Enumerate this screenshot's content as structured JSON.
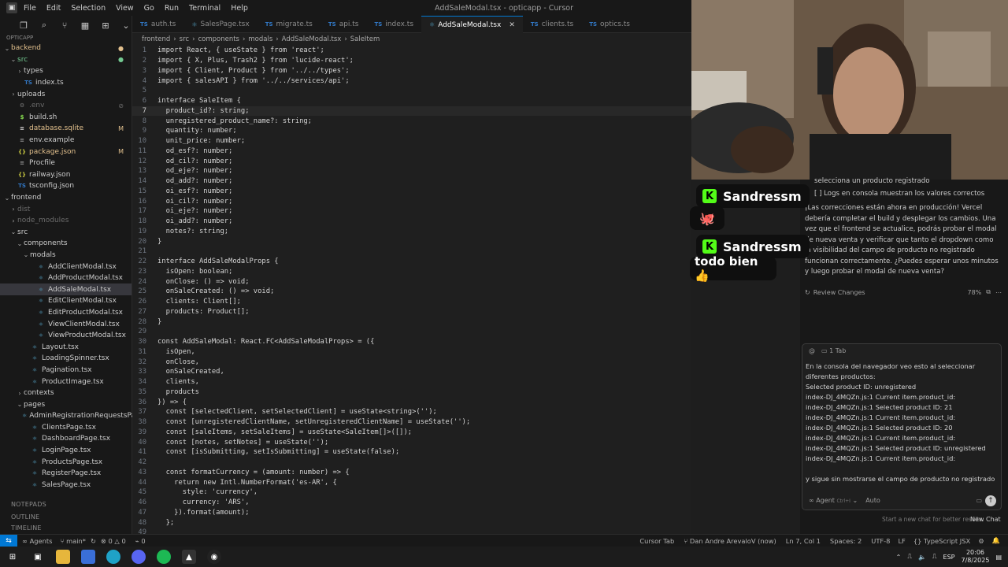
{
  "window": {
    "title": "AddSaleModal.tsx - opticapp - Cursor",
    "menu": [
      "File",
      "Edit",
      "Selection",
      "View",
      "Go",
      "Run",
      "Terminal",
      "Help"
    ]
  },
  "explorer": {
    "header": "OPTICAPP",
    "items": [
      {
        "label": "backend",
        "depth": 0,
        "kind": "folder-open",
        "state": "mod",
        "badge": "●"
      },
      {
        "label": "src",
        "depth": 1,
        "kind": "folder-open",
        "state": "add",
        "badge": "●"
      },
      {
        "label": "types",
        "depth": 2,
        "kind": "folder",
        "state": ""
      },
      {
        "label": "index.ts",
        "depth": 2,
        "kind": "ts",
        "state": ""
      },
      {
        "label": "uploads",
        "depth": 1,
        "kind": "folder",
        "state": ""
      },
      {
        "label": ".env",
        "depth": 1,
        "kind": "gear",
        "state": "dim",
        "badge": "⊘"
      },
      {
        "label": "build.sh",
        "depth": 1,
        "kind": "sh",
        "state": ""
      },
      {
        "label": "database.sqlite",
        "depth": 1,
        "kind": "db",
        "state": "mod",
        "badge": "M"
      },
      {
        "label": "env.example",
        "depth": 1,
        "kind": "txt",
        "state": ""
      },
      {
        "label": "package.json",
        "depth": 1,
        "kind": "json",
        "state": "mod",
        "badge": "M"
      },
      {
        "label": "Procfile",
        "depth": 1,
        "kind": "txt",
        "state": ""
      },
      {
        "label": "railway.json",
        "depth": 1,
        "kind": "json",
        "state": ""
      },
      {
        "label": "tsconfig.json",
        "depth": 1,
        "kind": "ts",
        "state": ""
      },
      {
        "label": "frontend",
        "depth": 0,
        "kind": "folder-open",
        "state": ""
      },
      {
        "label": "dist",
        "depth": 1,
        "kind": "folder",
        "state": "dim"
      },
      {
        "label": "node_modules",
        "depth": 1,
        "kind": "folder",
        "state": "dim"
      },
      {
        "label": "src",
        "depth": 1,
        "kind": "folder-open",
        "state": ""
      },
      {
        "label": "components",
        "depth": 2,
        "kind": "folder-open",
        "state": ""
      },
      {
        "label": "modals",
        "depth": 3,
        "kind": "folder-open",
        "state": ""
      },
      {
        "label": "AddClientModal.tsx",
        "depth": 4,
        "kind": "tsx",
        "state": ""
      },
      {
        "label": "AddProductModal.tsx",
        "depth": 4,
        "kind": "tsx",
        "state": ""
      },
      {
        "label": "AddSaleModal.tsx",
        "depth": 4,
        "kind": "tsx",
        "state": "selected"
      },
      {
        "label": "EditClientModal.tsx",
        "depth": 4,
        "kind": "tsx",
        "state": ""
      },
      {
        "label": "EditProductModal.tsx",
        "depth": 4,
        "kind": "tsx",
        "state": ""
      },
      {
        "label": "ViewClientModal.tsx",
        "depth": 4,
        "kind": "tsx",
        "state": ""
      },
      {
        "label": "ViewProductModal.tsx",
        "depth": 4,
        "kind": "tsx",
        "state": ""
      },
      {
        "label": "Layout.tsx",
        "depth": 3,
        "kind": "tsx",
        "state": ""
      },
      {
        "label": "LoadingSpinner.tsx",
        "depth": 3,
        "kind": "tsx",
        "state": ""
      },
      {
        "label": "Pagination.tsx",
        "depth": 3,
        "kind": "tsx",
        "state": ""
      },
      {
        "label": "ProductImage.tsx",
        "depth": 3,
        "kind": "tsx",
        "state": ""
      },
      {
        "label": "contexts",
        "depth": 2,
        "kind": "folder",
        "state": ""
      },
      {
        "label": "pages",
        "depth": 2,
        "kind": "folder-open",
        "state": ""
      },
      {
        "label": "AdminRegistrationRequestsPag...",
        "depth": 3,
        "kind": "tsx",
        "state": ""
      },
      {
        "label": "ClientsPage.tsx",
        "depth": 3,
        "kind": "tsx",
        "state": ""
      },
      {
        "label": "DashboardPage.tsx",
        "depth": 3,
        "kind": "tsx",
        "state": ""
      },
      {
        "label": "LoginPage.tsx",
        "depth": 3,
        "kind": "tsx",
        "state": ""
      },
      {
        "label": "ProductsPage.tsx",
        "depth": 3,
        "kind": "tsx",
        "state": ""
      },
      {
        "label": "RegisterPage.tsx",
        "depth": 3,
        "kind": "tsx",
        "state": ""
      },
      {
        "label": "SalesPage.tsx",
        "depth": 3,
        "kind": "tsx",
        "state": ""
      }
    ],
    "sections": [
      "NOTEPADS",
      "OUTLINE",
      "TIMELINE"
    ]
  },
  "tabs": [
    {
      "label": "auth.ts",
      "kind": "ts"
    },
    {
      "label": "SalesPage.tsx",
      "kind": "tsx"
    },
    {
      "label": "migrate.ts",
      "kind": "ts"
    },
    {
      "label": "api.ts",
      "kind": "ts"
    },
    {
      "label": "index.ts",
      "kind": "ts"
    },
    {
      "label": "AddSaleModal.tsx",
      "kind": "tsx",
      "active": true
    },
    {
      "label": "clients.ts",
      "kind": "ts"
    },
    {
      "label": "optics.ts",
      "kind": "ts"
    }
  ],
  "breadcrumb": [
    "frontend",
    "src",
    "components",
    "modals",
    "AddSaleModal.tsx",
    "SaleItem"
  ],
  "code": {
    "current_line": 7,
    "lines": [
      "import React, { useState } from 'react';",
      "import { X, Plus, Trash2 } from 'lucide-react';",
      "import { Client, Product } from '../../types';",
      "import { salesAPI } from '../../services/api';",
      "",
      "interface SaleItem {",
      "  product_id?: string;",
      "  unregistered_product_name?: string;",
      "  quantity: number;",
      "  unit_price: number;",
      "  od_esf?: number;",
      "  od_cil?: number;",
      "  od_eje?: number;",
      "  od_add?: number;",
      "  oi_esf?: number;",
      "  oi_cil?: number;",
      "  oi_eje?: number;",
      "  oi_add?: number;",
      "  notes?: string;",
      "}",
      "",
      "interface AddSaleModalProps {",
      "  isOpen: boolean;",
      "  onClose: () => void;",
      "  onSaleCreated: () => void;",
      "  clients: Client[];",
      "  products: Product[];",
      "}",
      "",
      "const AddSaleModal: React.FC<AddSaleModalProps> = ({",
      "  isOpen,",
      "  onClose,",
      "  onSaleCreated,",
      "  clients,",
      "  products",
      "}) => {",
      "  const [selectedClient, setSelectedClient] = useState<string>('');",
      "  const [unregisteredClientName, setUnregisteredClientName] = useState('');",
      "  const [saleItems, setSaleItems] = useState<SaleItem[]>([]);",
      "  const [notes, setNotes] = useState('');",
      "  const [isSubmitting, setIsSubmitting] = useState(false);",
      "",
      "  const formatCurrency = (amount: number) => {",
      "    return new Intl.NumberFormat('es-AR', {",
      "      style: 'currency',",
      "      currency: 'ARS',",
      "    }).format(amount);",
      "  };",
      ""
    ]
  },
  "stream": {
    "name1": "Sandressm",
    "emoji1": "🐙",
    "name2": "Sandressm",
    "message2": "todo bien 👍"
  },
  "chat": {
    "top_lines": [
      "selecciona un producto registrado",
      "[ ] Logs en consola muestran los valores correctos"
    ],
    "paragraph": "¡Las correcciones están ahora en producción! Vercel debería completar el build y desplegar los cambios. Una vez que el frontend se actualice, podrás probar el modal de nueva venta y verificar que tanto el dropdown como la visibilidad del campo de producto no registrado funcionan correctamente. ¿Puedes esperar unos minutos y luego probar el modal de nueva venta?",
    "review_label": "Review Changes",
    "review_pct": "78%",
    "input_tab": "1 Tab",
    "input_lines": [
      "En la consola del navegador veo esto al seleccionar diferentes productos:",
      "Selected product ID: unregistered",
      "index-DJ_4MQZn.js:1 Current item.product_id:",
      "index-DJ_4MQZn.js:1 Selected product ID: 21",
      "index-DJ_4MQZn.js:1 Current item.product_id:",
      "index-DJ_4MQZn.js:1 Selected product ID: 20",
      "index-DJ_4MQZn.js:1 Current item.product_id:",
      "index-DJ_4MQZn.js:1 Selected product ID: unregistered",
      "index-DJ_4MQZn.js:1 Current item.product_id:",
      "",
      "y sigue sin mostrarse el campo de producto no registrado"
    ],
    "agent_label": "Agent",
    "agent_shortcut": "Ctrl+I",
    "auto_label": "Auto",
    "footer_hint": "Start a new chat for better results.",
    "new_chat": "New Chat"
  },
  "status": {
    "agents": "Agents",
    "branch": "main*",
    "errors": "0",
    "warnings": "0",
    "cursor_tab": "Cursor Tab",
    "author": "Dan Andre ArevaloV (now)",
    "position": "Ln 7, Col 1",
    "spaces": "Spaces: 2",
    "encoding": "UTF-8",
    "eol": "LF",
    "language": "TypeScript JSX"
  },
  "taskbar": {
    "lang": "ESP",
    "time": "20:06",
    "date": "7/8/2025"
  }
}
